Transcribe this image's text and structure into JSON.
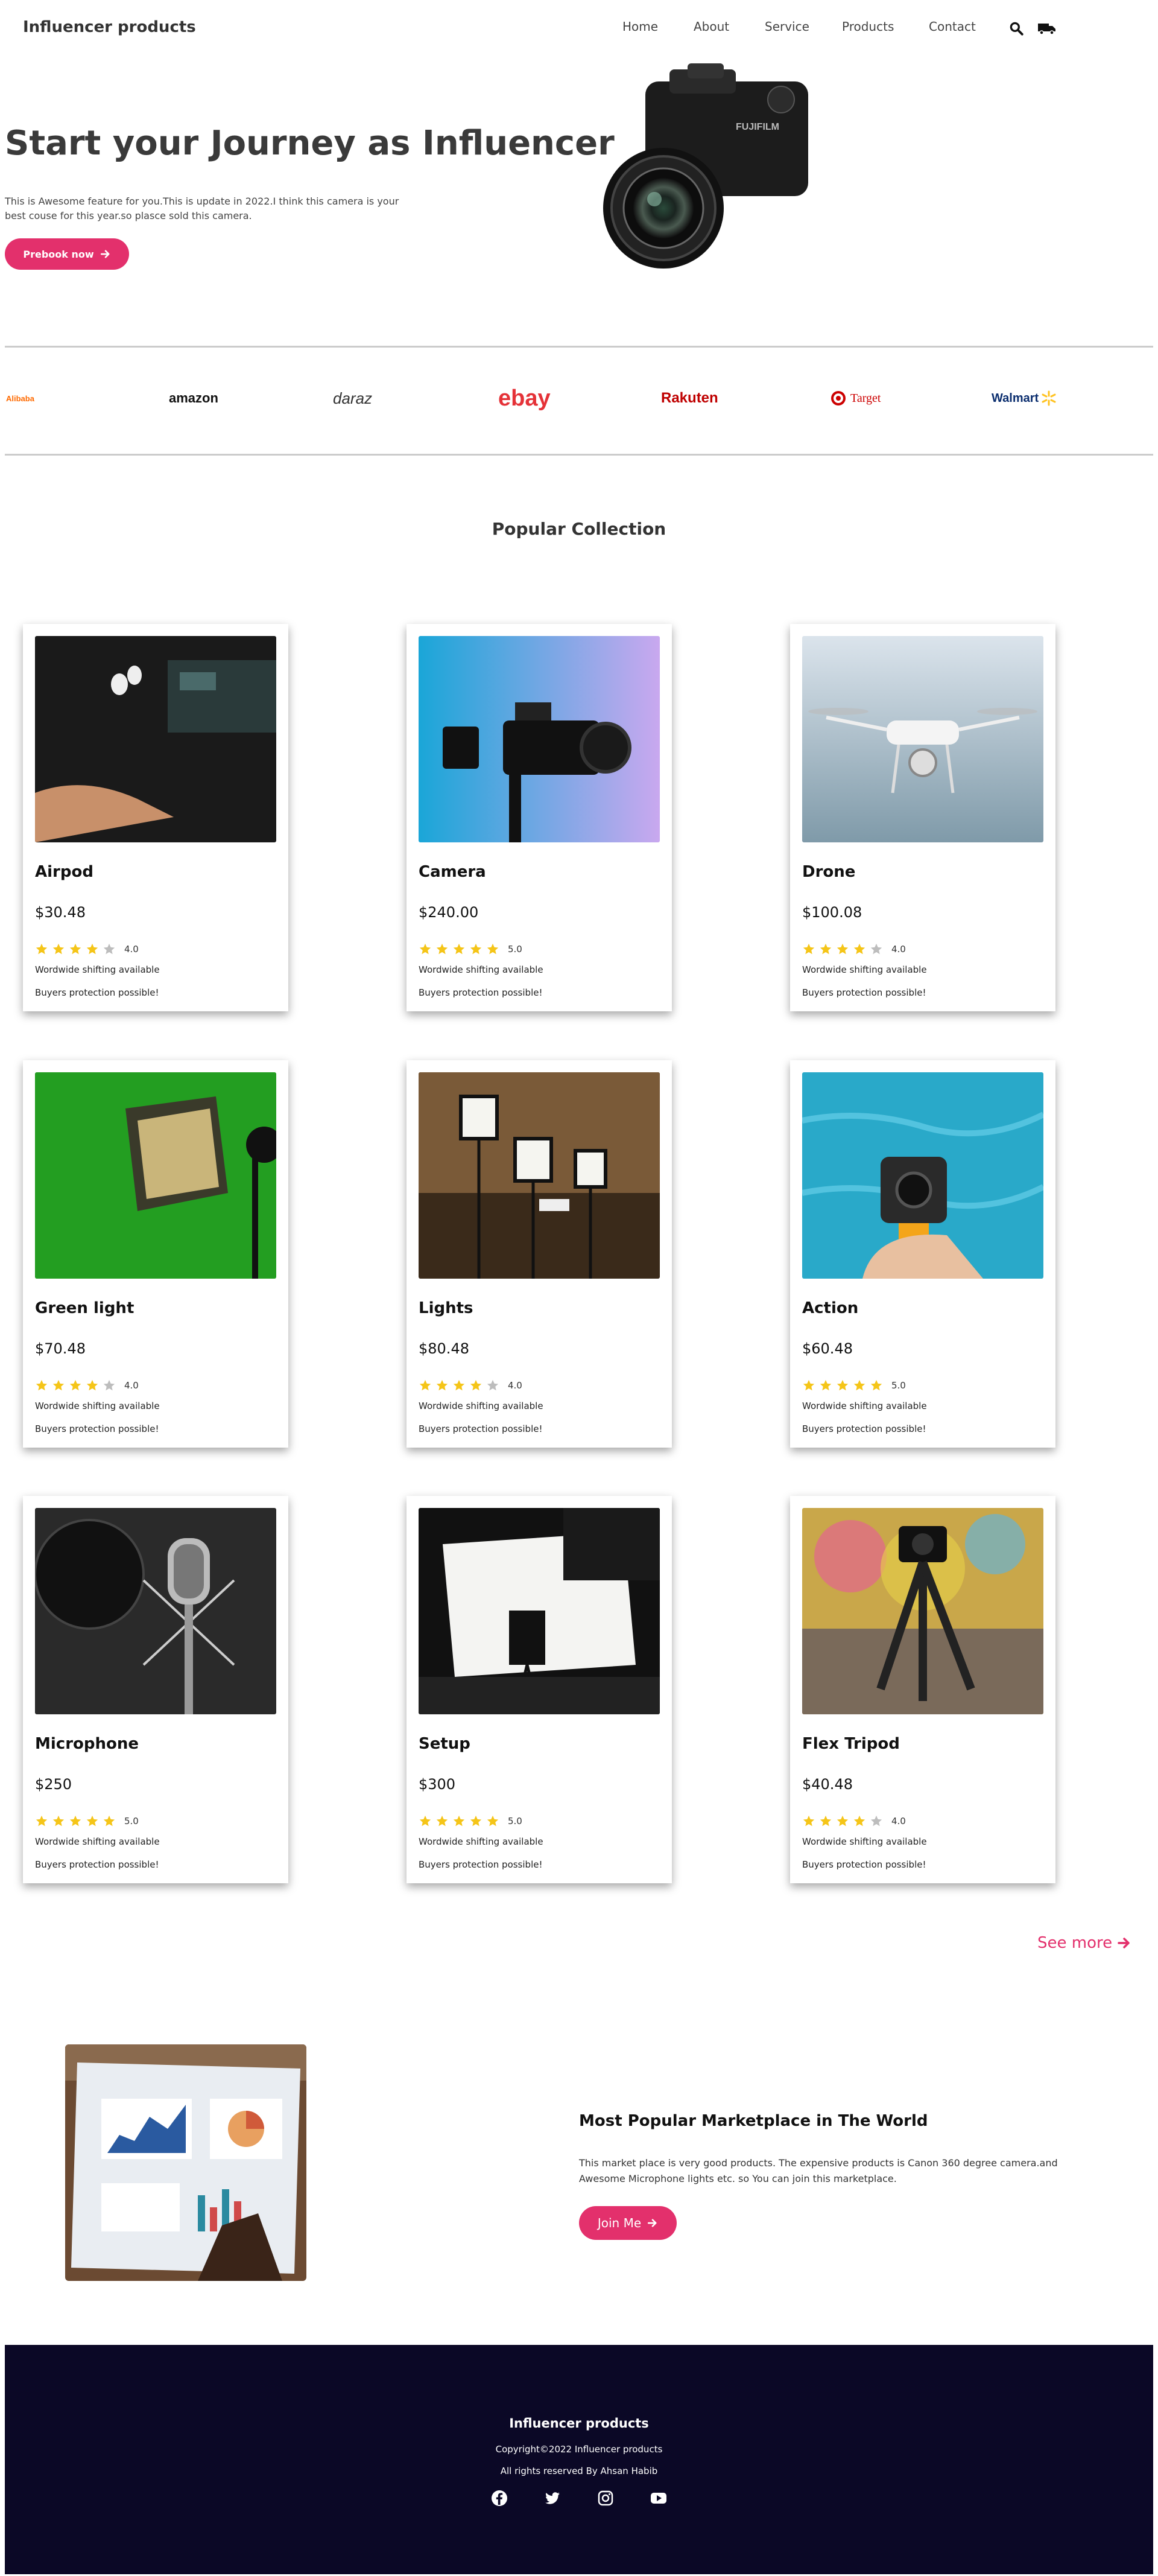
{
  "brand": "Influencer products",
  "nav": [
    "Home",
    "About",
    "Service",
    "Products",
    "Contact"
  ],
  "hero": {
    "title": "Start your Journey as Influencer",
    "text": "This is Awesome feature for you.This is update in 2022.I think this camera is your best couse for this year.so plasce sold this camera.",
    "button": "Prebook now"
  },
  "logos": [
    "Alibaba",
    "amazon",
    "daraz",
    "ebay",
    "Rakuten",
    "Target",
    "Walmart"
  ],
  "collection_title": "Popular Collection",
  "products": [
    {
      "name": "Airpod",
      "price": "$30.48",
      "rating": "4.0",
      "stars": 4,
      "line1": "Wordwide shifting available",
      "line2": "Buyers protection possible!"
    },
    {
      "name": "Camera",
      "price": "$240.00",
      "rating": "5.0",
      "stars": 5,
      "line1": "Wordwide shifting available",
      "line2": "Buyers protection possible!"
    },
    {
      "name": "Drone",
      "price": "$100.08",
      "rating": "4.0",
      "stars": 4,
      "line1": "Wordwide shifting available",
      "line2": "Buyers protection possible!"
    },
    {
      "name": "Green light",
      "price": "$70.48",
      "rating": "4.0",
      "stars": 4,
      "line1": "Wordwide shifting available",
      "line2": "Buyers protection possible!"
    },
    {
      "name": "Lights",
      "price": "$80.48",
      "rating": "4.0",
      "stars": 4,
      "line1": "Wordwide shifting available",
      "line2": "Buyers protection possible!"
    },
    {
      "name": "Action",
      "price": "$60.48",
      "rating": "5.0",
      "stars": 5,
      "line1": "Wordwide shifting available",
      "line2": "Buyers protection possible!"
    },
    {
      "name": "Microphone",
      "price": "$250",
      "rating": "5.0",
      "stars": 5,
      "line1": "Wordwide shifting available",
      "line2": "Buyers protection possible!"
    },
    {
      "name": "Setup",
      "price": "$300",
      "rating": "5.0",
      "stars": 5,
      "line1": "Wordwide shifting available",
      "line2": "Buyers protection possible!"
    },
    {
      "name": "Flex Tripod",
      "price": "$40.48",
      "rating": "4.0",
      "stars": 4,
      "line1": "Wordwide shifting available",
      "line2": "Buyers protection possible!"
    }
  ],
  "see_more": "See more",
  "marketplace": {
    "title": "Most Popular Marketplace in The World",
    "text": "This market place is very good products. The expensive products is Canon 360 degree camera.and Awesome Microphone lights etc. so You can join this marketplace.",
    "button": "Join Me"
  },
  "footer": {
    "title": "Influencer products",
    "copyright": "Copyright©2022 Influencer products",
    "rights": "All rights reserved By Ahsan Habib"
  },
  "colors": {
    "accent": "#e3306c",
    "footer_bg": "#0b0826",
    "star": "#f5c518",
    "star_empty": "#bdbdbd"
  },
  "icons": [
    "search-icon",
    "truck-icon",
    "arrow-right-icon",
    "star-icon",
    "facebook-icon",
    "twitter-icon",
    "instagram-icon",
    "youtube-icon"
  ]
}
